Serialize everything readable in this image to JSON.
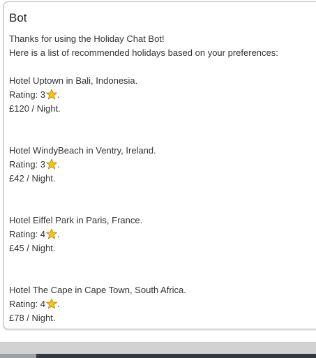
{
  "chat": {
    "sender": "Bot",
    "intro_line1": "Thanks for using the Holiday Chat Bot!",
    "intro_line2": "Here is a list of recommended holidays based on your preferences:",
    "hotels": [
      {
        "name_line": "Hotel Uptown in Bali, Indonesia.",
        "rating_prefix": "Rating: 3",
        "rating_suffix": ".",
        "price_line": "£120 / Night.",
        "rating": 3
      },
      {
        "name_line": "Hotel WindyBeach in Ventry, Ireland.",
        "rating_prefix": "Rating: 3",
        "rating_suffix": ".",
        "price_line": "£42 / Night.",
        "rating": 3
      },
      {
        "name_line": "Hotel Eiffel Park in Paris, France.",
        "rating_prefix": "Rating: 4",
        "rating_suffix": ".",
        "price_line": "£45 / Night.",
        "rating": 4
      },
      {
        "name_line": "Hotel The Cape in Cape Town, South Africa.",
        "rating_prefix": "Rating: 4",
        "rating_suffix": ".",
        "price_line": "£78 / Night.",
        "rating": 4
      }
    ]
  },
  "icons": {
    "rating_icon": "star-icon"
  },
  "colors": {
    "star_fill": "#f5c518",
    "star_stroke": "#c08a00",
    "bottom_bar": "#d2d2d2",
    "bottom_dark": "#2f3a44"
  }
}
